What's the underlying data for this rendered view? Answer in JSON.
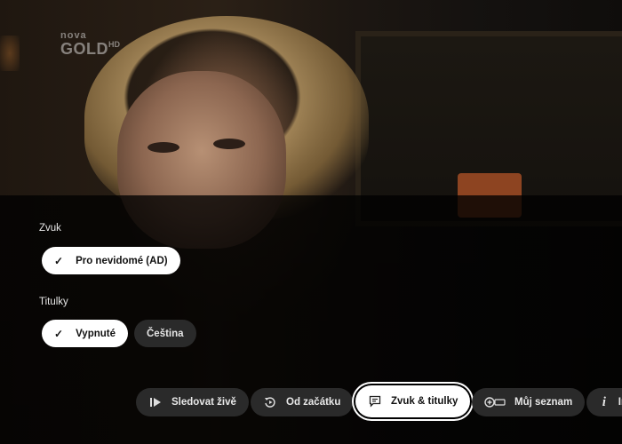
{
  "channel": {
    "name_small": "nova",
    "name_big": "GOLD",
    "suffix": "HD"
  },
  "audio": {
    "title": "Zvuk",
    "options": [
      {
        "label": "Pro nevidomé (AD)",
        "selected": true
      }
    ]
  },
  "subtitles": {
    "title": "Titulky",
    "options": [
      {
        "label": "Vypnuté",
        "selected": true
      },
      {
        "label": "Čeština",
        "selected": false
      }
    ]
  },
  "actions": [
    {
      "label": "Sledovat živě",
      "icon": "live-icon"
    },
    {
      "label": "Od začátku",
      "icon": "restart-icon"
    },
    {
      "label": "Zvuk & titulky",
      "icon": "subtitles-icon",
      "focused": true
    },
    {
      "label": "Můj seznam",
      "icon": "add-list-icon"
    },
    {
      "label": "In",
      "icon": "info-icon"
    }
  ],
  "check_glyph": "✓",
  "info_glyph": "i"
}
